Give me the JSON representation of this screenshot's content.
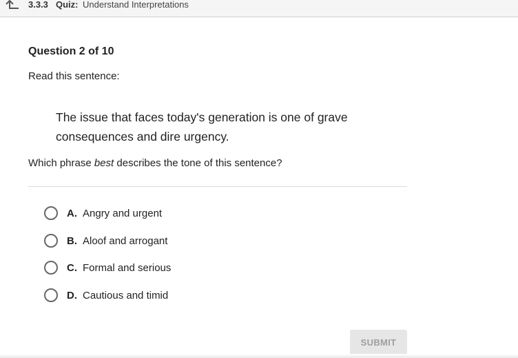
{
  "header": {
    "course_number": "3.3.3",
    "quiz_label": "Quiz:",
    "quiz_title": "Understand Interpretations",
    "back_icon": "back-arrow-icon"
  },
  "question": {
    "number_text": "Question 2 of 10",
    "instruction": "Read this sentence:",
    "quote": "The issue that faces today's generation is one of grave consequences and dire urgency.",
    "prompt_before": "Which phrase ",
    "prompt_emphasis": "best",
    "prompt_after": " describes the tone of this sentence?"
  },
  "options": [
    {
      "letter": "A.",
      "text": "Angry and urgent"
    },
    {
      "letter": "B.",
      "text": "Aloof and arrogant"
    },
    {
      "letter": "C.",
      "text": "Formal and serious"
    },
    {
      "letter": "D.",
      "text": "Cautious and timid"
    }
  ],
  "submit": {
    "label": "SUBMIT",
    "enabled": false
  }
}
